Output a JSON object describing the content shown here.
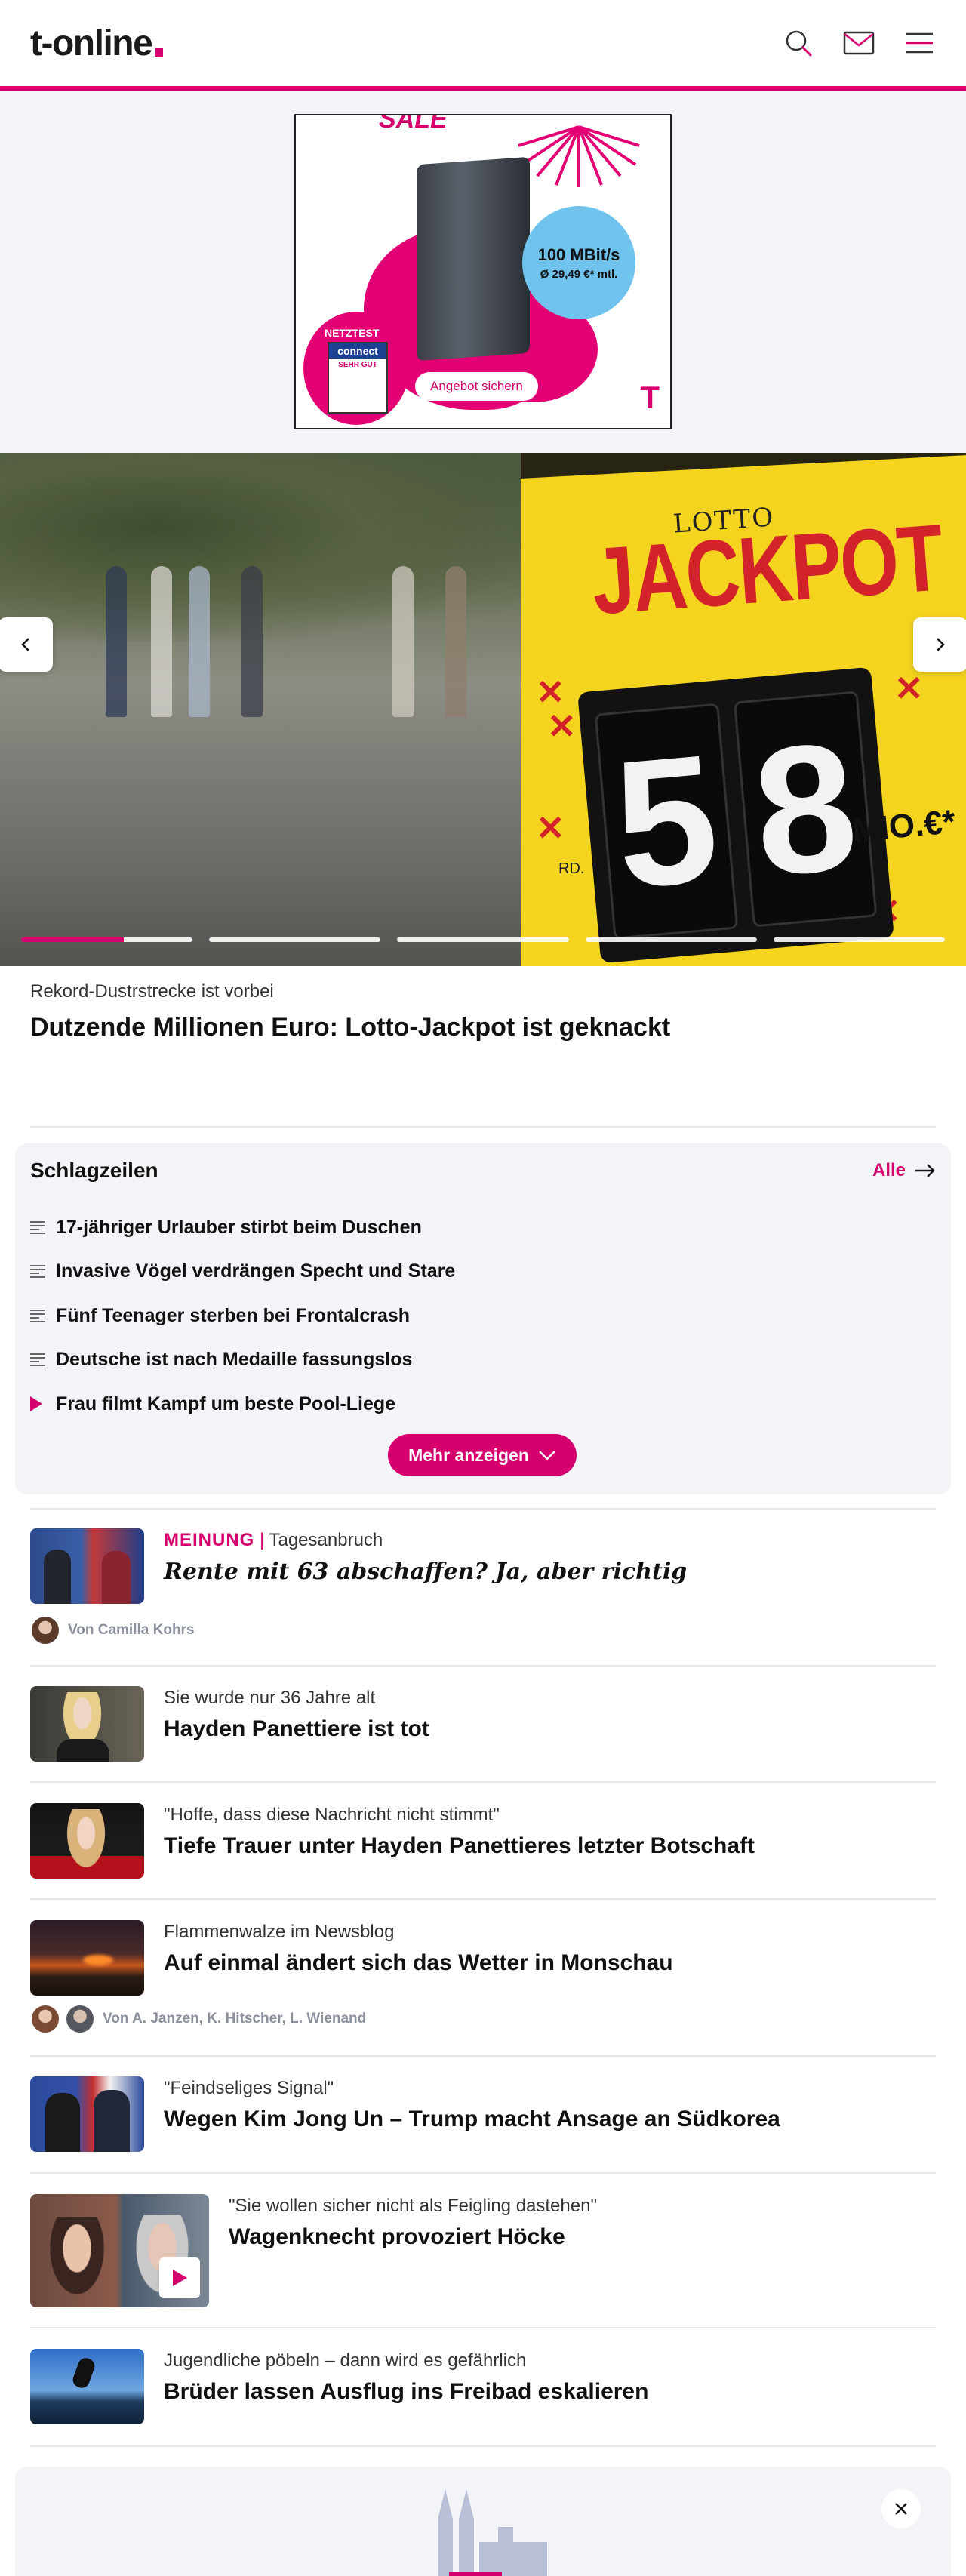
{
  "header": {
    "logo_text": "t-online",
    "brand_color": "#d5006d"
  },
  "ad": {
    "sale": "SALE",
    "speed": "100 MBit/s",
    "price": "Ø 29,49 €* mtl.",
    "netztest": "NETZTEST",
    "badge_brand": "connect",
    "badge_grade": "SEHR GUT",
    "cta": "Angebot sichern",
    "t_logo": "T"
  },
  "hero": {
    "image_texts": {
      "lotto": "LOTTO",
      "jackpot": "JACKPOT",
      "digit1": "5",
      "digit2": "8",
      "mio": "MIO.€*",
      "rd": "RD."
    },
    "progress": [
      0.6,
      0,
      0,
      0,
      0
    ],
    "kicker": "Rekord-Dustrstrecke ist vorbei",
    "title": "Dutzende Millionen Euro: Lotto-Jackpot ist geknackt"
  },
  "schlagzeilen": {
    "title": "Schlagzeilen",
    "all_label": "Alle",
    "items": [
      {
        "label": "17-jähriger Urlauber stirbt beim Duschen",
        "icon": "article-lines-icon"
      },
      {
        "label": "Invasive Vögel verdrängen Specht und Stare",
        "icon": "article-lines-icon"
      },
      {
        "label": "Fünf Teenager sterben bei Frontalcrash",
        "icon": "article-lines-icon"
      },
      {
        "label": "Deutsche ist nach Medaille fassungslos",
        "icon": "article-lines-icon"
      },
      {
        "label": "Frau filmt Kampf um beste Pool-Liege",
        "icon": "video-play-icon"
      }
    ],
    "more_label": "Mehr anzeigen"
  },
  "articles": [
    {
      "category": "MEINUNG",
      "kicker": "Tagesanbruch",
      "title": "Rente mit 63 abschaffen? Ja, aber richtig",
      "author": "Von Camilla Kohrs"
    },
    {
      "kicker": "Sie wurde nur 36 Jahre alt",
      "title": "Hayden Panettiere ist tot"
    },
    {
      "kicker": "\"Hoffe, dass diese Nachricht nicht stimmt\"",
      "title": "Tiefe Trauer unter Hayden Panettieres letzter Botschaft"
    },
    {
      "kicker": "Flammenwalze im Newsblog",
      "title": "Auf einmal ändert sich das Wetter in Monschau",
      "author": "Von A. Janzen, K. Hitscher, L. Wienand"
    },
    {
      "kicker": "\"Feindseliges Signal\"",
      "title": "Wegen Kim Jong Un – Trump macht Ansage an Südkorea"
    },
    {
      "kicker": "\"Sie wollen sicher nicht als Feigling dastehen\"",
      "title": "Wagenknecht provoziert Höcke"
    },
    {
      "kicker": "Jugendliche pöbeln – dann wird es gefährlich",
      "title": "Brüder lassen Ausflug ins Freibad eskalieren"
    }
  ]
}
